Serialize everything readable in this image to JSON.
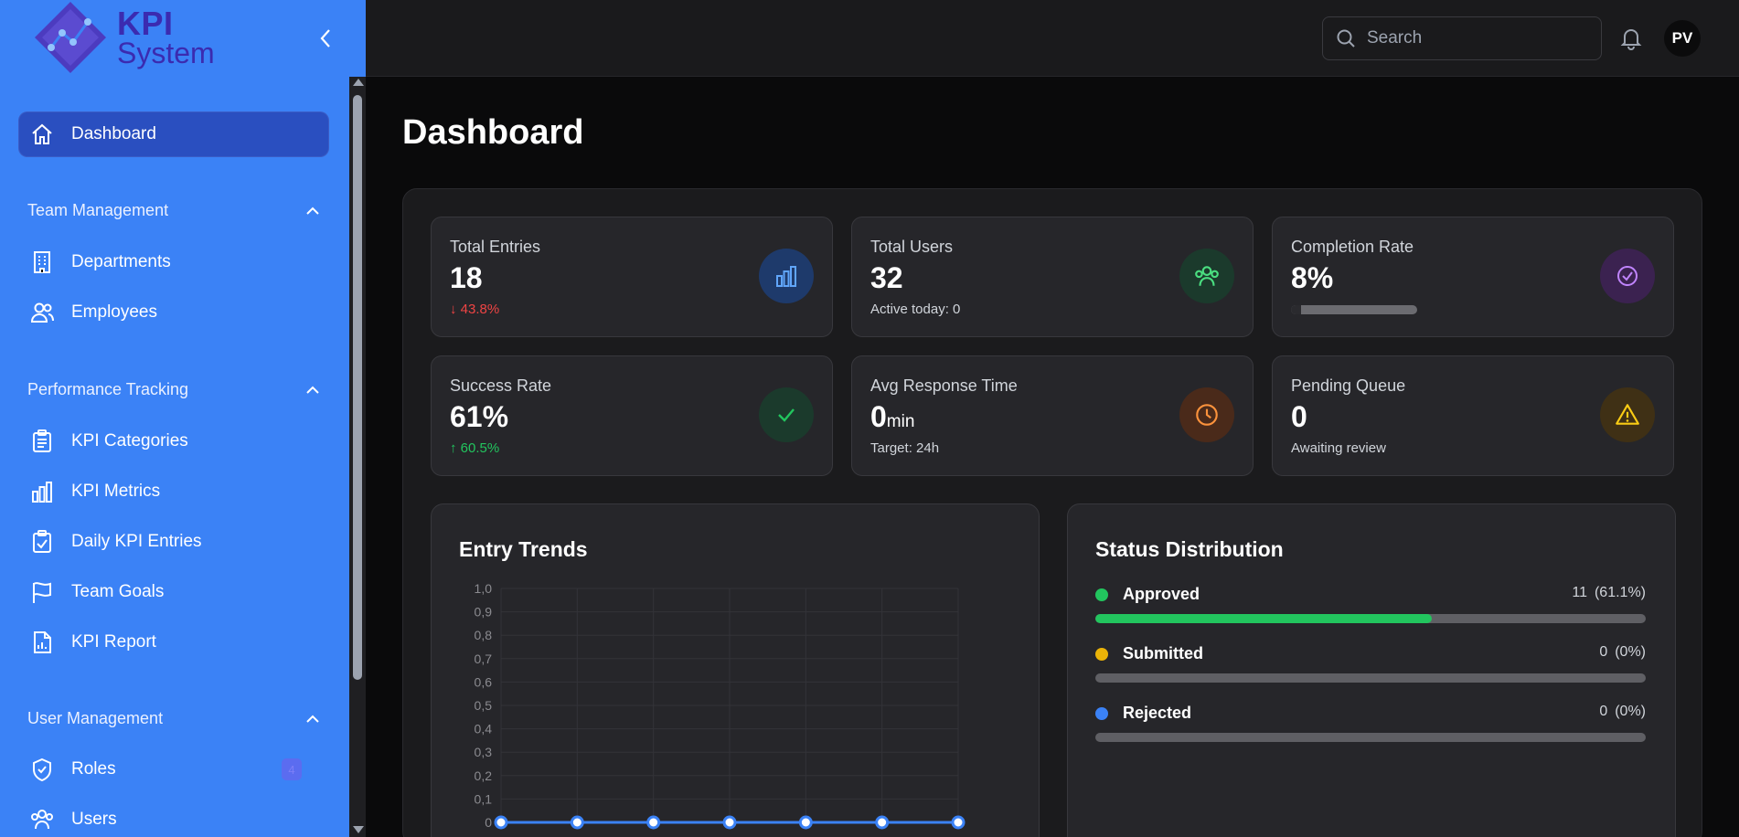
{
  "logo": {
    "line1": "KPI",
    "line2": "System"
  },
  "sidebar": {
    "dashboard": "Dashboard",
    "sections": [
      {
        "title": "Team Management",
        "items": [
          "Departments",
          "Employees"
        ]
      },
      {
        "title": "Performance Tracking",
        "items": [
          "KPI Categories",
          "KPI Metrics",
          "Daily KPI Entries",
          "Team Goals",
          "KPI Report"
        ]
      },
      {
        "title": "User Management",
        "items": [
          "Roles",
          "Users"
        ]
      }
    ],
    "roles_badge": "4"
  },
  "topbar": {
    "search_placeholder": "Search",
    "avatar_initials": "PV"
  },
  "page": {
    "title": "Dashboard"
  },
  "stats": {
    "total_entries": {
      "label": "Total Entries",
      "value": "18",
      "trend": "43.8%"
    },
    "total_users": {
      "label": "Total Users",
      "value": "32",
      "sub": "Active today: 0"
    },
    "completion_rate": {
      "label": "Completion Rate",
      "value": "8%",
      "progress": 0.08
    },
    "success_rate": {
      "label": "Success Rate",
      "value": "61%",
      "trend": "60.5%"
    },
    "avg_response": {
      "label": "Avg Response Time",
      "value": "0",
      "unit": "min",
      "sub": "Target: 24h"
    },
    "pending_queue": {
      "label": "Pending Queue",
      "value": "0",
      "sub": "Awaiting review"
    }
  },
  "entry_trends": {
    "title": "Entry Trends"
  },
  "chart_data": {
    "type": "line",
    "title": "Entry Trends",
    "y_ticks": [
      "1,0",
      "0,9",
      "0,8",
      "0,7",
      "0,6",
      "0,5",
      "0,4",
      "0,3",
      "0,2",
      "0,1",
      "0"
    ],
    "ylim": [
      0,
      1
    ],
    "series": [
      {
        "values": [
          0,
          0,
          0,
          0,
          0,
          0,
          0
        ]
      }
    ],
    "grid": true,
    "colors": {
      "line": "#3b82f6"
    }
  },
  "status_distribution": {
    "title": "Status Distribution",
    "items": [
      {
        "name": "Approved",
        "count": "11",
        "pct": "(61.1%)",
        "fraction": 0.611,
        "color": "#22c55e"
      },
      {
        "name": "Submitted",
        "count": "0",
        "pct": "(0%)",
        "fraction": 0,
        "color": "#eab308"
      },
      {
        "name": "Rejected",
        "count": "0",
        "pct": "(0%)",
        "fraction": 0,
        "color": "#3b82f6"
      }
    ]
  }
}
